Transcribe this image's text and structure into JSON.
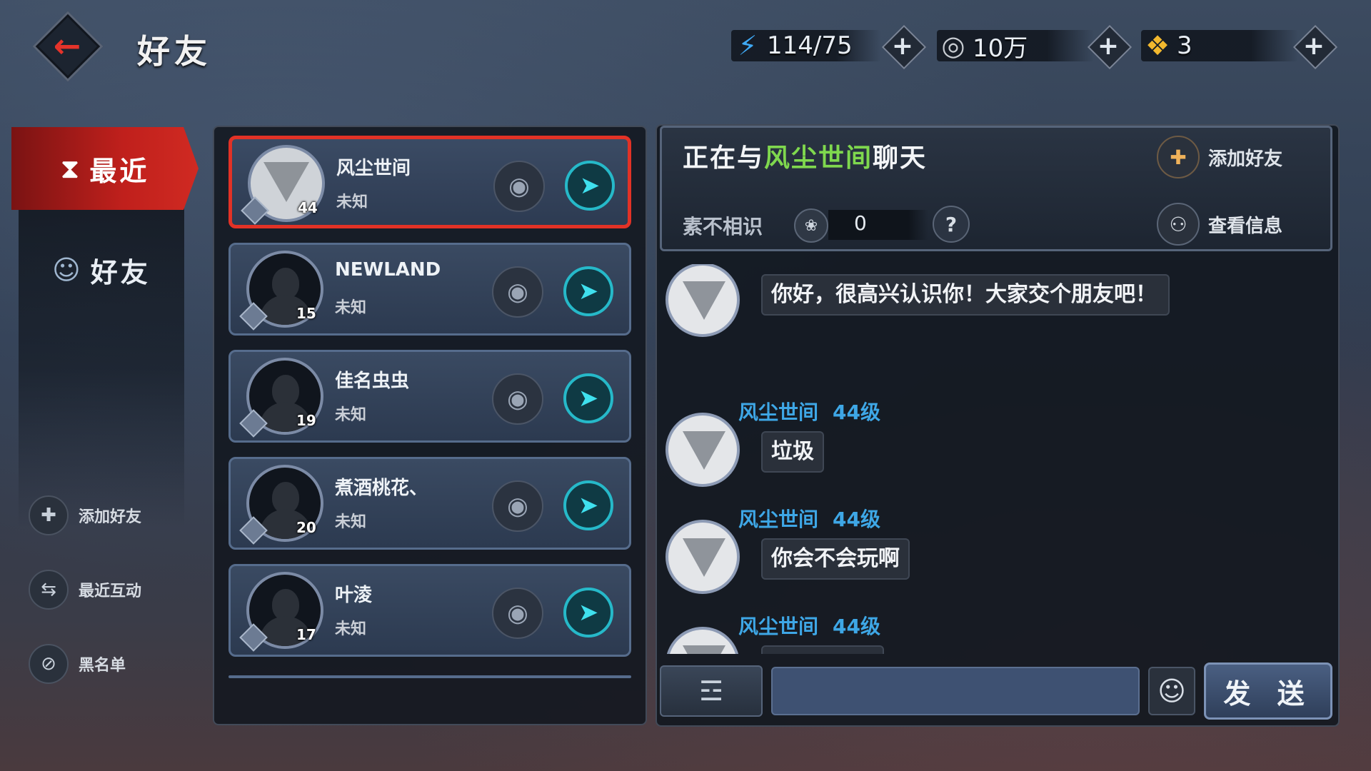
{
  "header": {
    "title": "好友",
    "resources": [
      {
        "name": "stamina",
        "icon": "lightning-icon",
        "value": "114/75",
        "color": "#3fa9f5"
      },
      {
        "name": "coins",
        "icon": "coin-icon",
        "value": "10万",
        "color": "#c8ccd2"
      },
      {
        "name": "gold-ingot",
        "icon": "gold-ingot-icon",
        "value": "3",
        "color": "#f2b82e"
      }
    ]
  },
  "nav": {
    "tabs": [
      {
        "label": "最近",
        "icon": "hourglass-icon",
        "active": true
      },
      {
        "label": "好友",
        "icon": "friends-icon",
        "active": false
      }
    ],
    "actions": [
      {
        "label": "添加好友",
        "icon": "add-friend-icon"
      },
      {
        "label": "最近互动",
        "icon": "swap-icon"
      },
      {
        "label": "黑名单",
        "icon": "block-icon"
      }
    ]
  },
  "friends": [
    {
      "name": "风尘世间",
      "status": "未知",
      "level": "44",
      "selected": true,
      "avatar": "triangle-emblem"
    },
    {
      "name": "NEWLAND",
      "status": "未知",
      "level": "15",
      "selected": false,
      "avatar": "silhouette"
    },
    {
      "name": "佳名虫虫",
      "status": "未知",
      "level": "19",
      "selected": false,
      "avatar": "silhouette"
    },
    {
      "name": "煮酒桃花、",
      "status": "未知",
      "level": "20",
      "selected": false,
      "avatar": "silhouette"
    },
    {
      "name": "叶淩",
      "status": "未知",
      "level": "17",
      "selected": false,
      "avatar": "silhouette"
    }
  ],
  "chat": {
    "prefix": "正在与",
    "partner": "风尘世间",
    "suffix": "聊天",
    "relation": "素不相识",
    "intimacy": "0",
    "help": "?",
    "add_friend_label": "添加好友",
    "view_info_label": "查看信息",
    "accent_color": "#7fd84e",
    "messages": [
      {
        "sender": "",
        "level": "",
        "text": "你好，很高兴认识你！大家交个朋友吧！"
      },
      {
        "sender": "风尘世间",
        "level": "44级",
        "text": "垃圾"
      },
      {
        "sender": "风尘世间",
        "level": "44级",
        "text": "你会不会玩啊"
      },
      {
        "sender": "风尘世间",
        "level": "44级",
        "text": ""
      }
    ],
    "input_value": "",
    "send_label": "发 送"
  }
}
